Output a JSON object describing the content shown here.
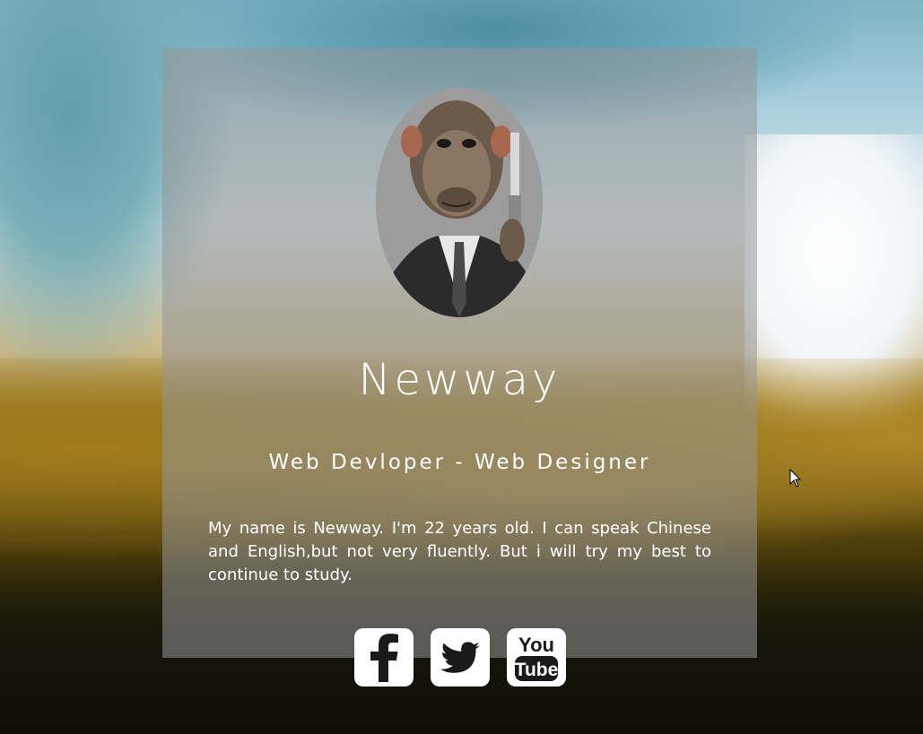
{
  "profile": {
    "name": "Newway",
    "role": "Web Devloper - Web Designer",
    "bio": "My name is Newway. I'm 22 years old. I can speak Chinese and English,but not very fluently. But i will try my best to continue to study."
  },
  "social": [
    {
      "icon": "facebook-icon"
    },
    {
      "icon": "twitter-icon"
    },
    {
      "icon": "youtube-icon",
      "text_top": "You",
      "text_bottom": "Tube"
    }
  ],
  "colors": {
    "card_overlay": "#969696",
    "text": "#ffffff",
    "icon_tile": "#ffffff",
    "icon_glyph": "#1a1a1a"
  }
}
